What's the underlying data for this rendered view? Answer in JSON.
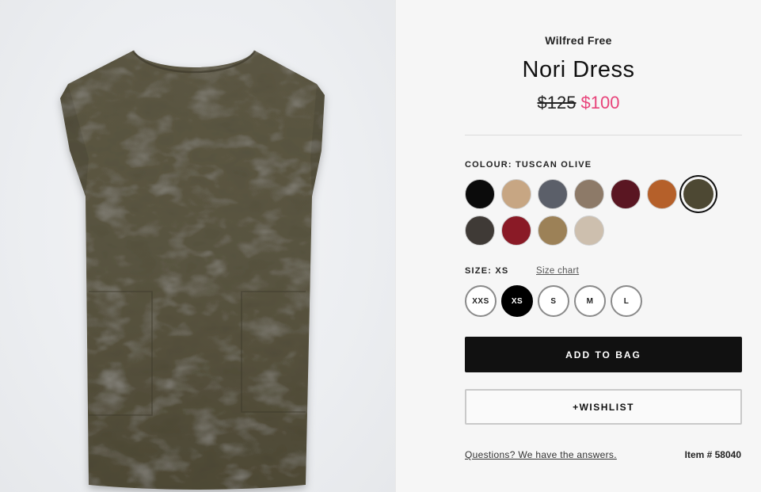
{
  "product": {
    "brand": "Wilfred Free",
    "name": "Nori Dress",
    "price_original": "$125",
    "price_sale": "$100",
    "image_alt": "Olive suede shift dress"
  },
  "colour": {
    "label": "COLOUR: TUSCAN OLIVE",
    "selected_index": 6,
    "swatches": [
      {
        "name": "black",
        "color": "#0b0b0b"
      },
      {
        "name": "camel",
        "color": "#c7a683"
      },
      {
        "name": "charcoal-blue",
        "color": "#5b5f69"
      },
      {
        "name": "taupe",
        "color": "#8d7a68"
      },
      {
        "name": "burgundy",
        "color": "#5a1622"
      },
      {
        "name": "cognac",
        "color": "#b5602a"
      },
      {
        "name": "tuscan-olive",
        "color": "#4d4833"
      },
      {
        "name": "dark-brown",
        "color": "#3f3a36"
      },
      {
        "name": "red",
        "color": "#8a1a26"
      },
      {
        "name": "tan",
        "color": "#9c8157"
      },
      {
        "name": "oatmeal",
        "color": "#cdbfae"
      }
    ]
  },
  "size": {
    "label": "SIZE: XS",
    "chart_link": "Size chart",
    "options": [
      "XXS",
      "XS",
      "S",
      "M",
      "L"
    ],
    "selected": "XS"
  },
  "actions": {
    "add_to_bag": "ADD TO BAG",
    "wishlist": "+WISHLIST"
  },
  "footer": {
    "questions_link": "Questions? We have the answers.",
    "item_number": "Item # 58040"
  },
  "colors": {
    "sale_price": "#e8437a",
    "button_dark": "#111111",
    "dress": "#5a5540"
  }
}
